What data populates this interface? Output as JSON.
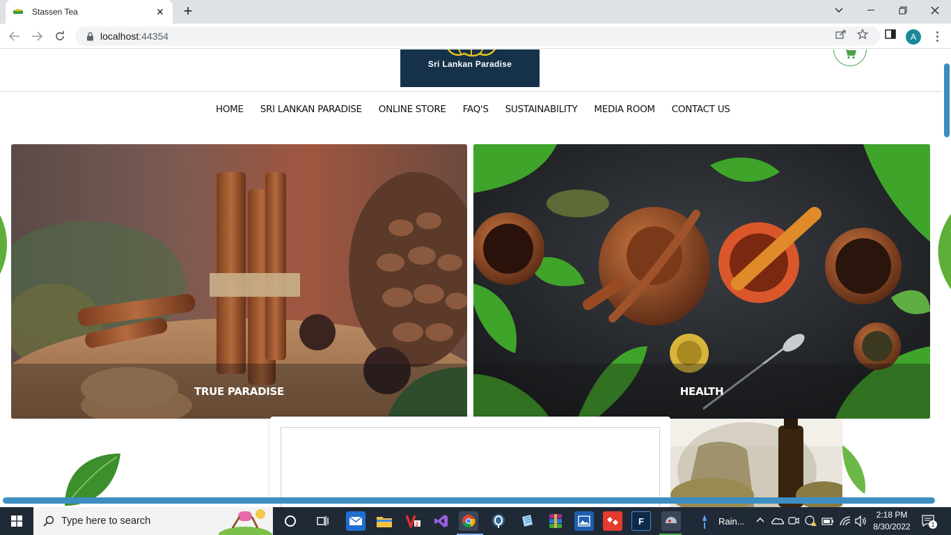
{
  "browser": {
    "tab_title": "Stassen Tea",
    "url_host": "localhost",
    "url_port": ":44354",
    "avatar_letter": "A"
  },
  "site": {
    "logo_text": "Sri Lankan Paradise",
    "nav": [
      "HOME",
      "SRI LANKAN PARADISE",
      "ONLINE STORE",
      "FAQ'S",
      "SUSTAINABILITY",
      "MEDIA ROOM",
      "CONTACT US"
    ],
    "banners": [
      {
        "caption": "TRUE PARADISE"
      },
      {
        "caption": "HEALTH"
      }
    ],
    "accent_color": "#4aa24a",
    "logo_bg": "#16324a"
  },
  "taskbar": {
    "search_placeholder": "Type here to search",
    "weather_text": "Rain...",
    "time": "2:18 PM",
    "date": "8/30/2022",
    "notification_count": "1"
  }
}
